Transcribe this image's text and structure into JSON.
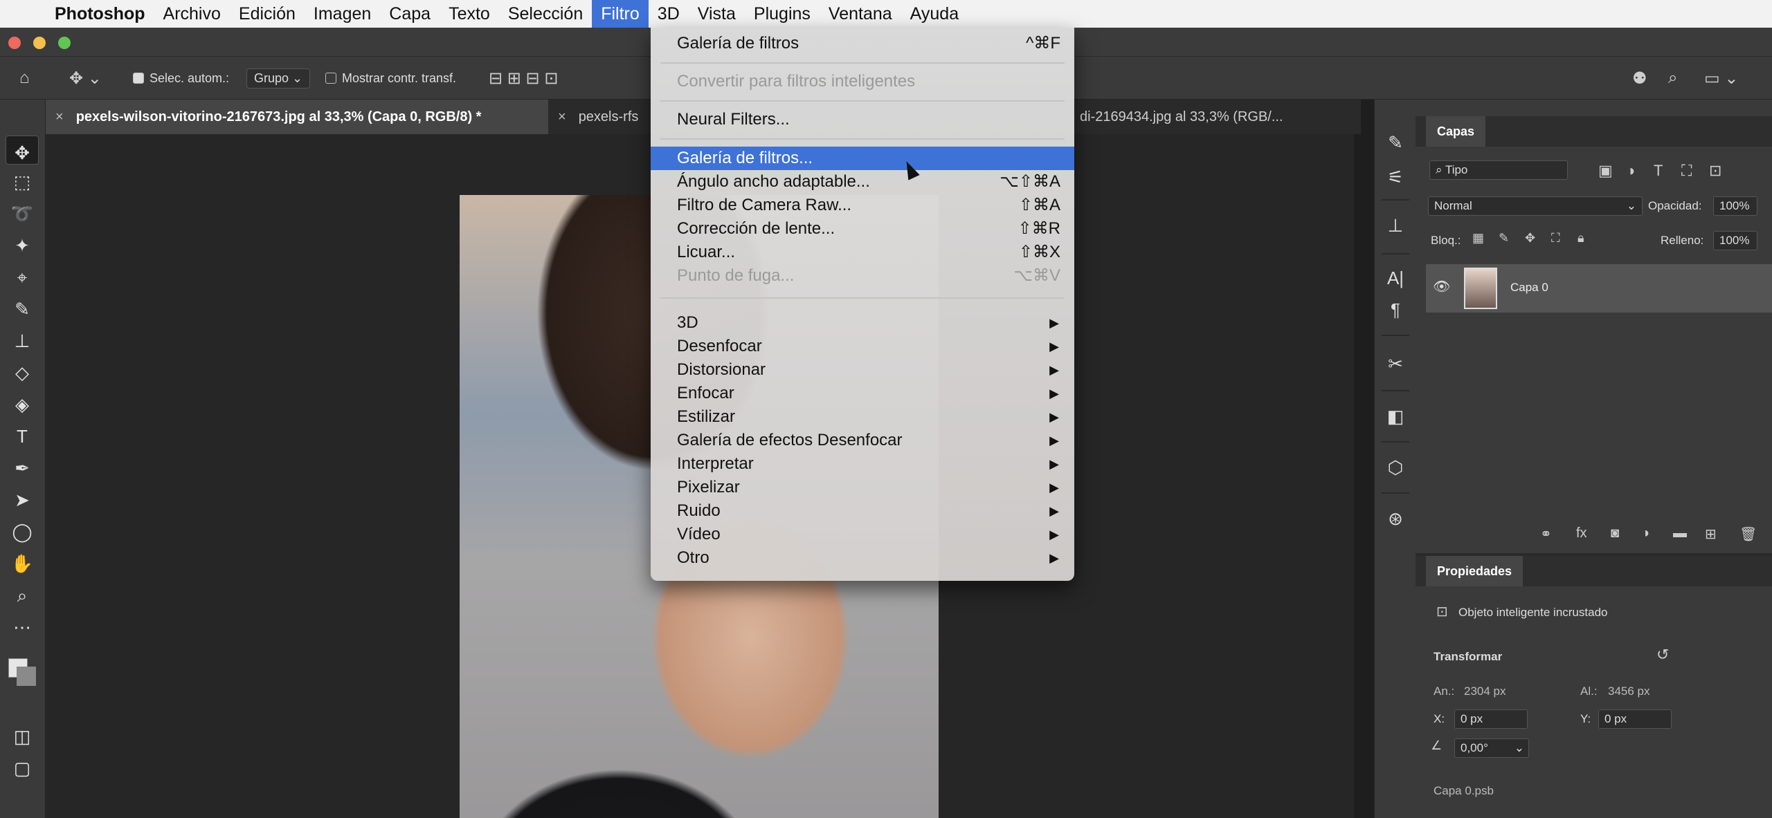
{
  "menubar": {
    "apple": "",
    "items": [
      {
        "label": "Photoshop",
        "bold": true
      },
      {
        "label": "Archivo"
      },
      {
        "label": "Edición"
      },
      {
        "label": "Imagen"
      },
      {
        "label": "Capa"
      },
      {
        "label": "Texto"
      },
      {
        "label": "Selección"
      },
      {
        "label": "Filtro",
        "active": true
      },
      {
        "label": "3D"
      },
      {
        "label": "Vista"
      },
      {
        "label": "Plugins"
      },
      {
        "label": "Ventana"
      },
      {
        "label": "Ayuda"
      }
    ]
  },
  "options_bar": {
    "auto_select_label": "Selec. autom.:",
    "auto_select_value": "Grupo",
    "show_transform_label": "Mostrar contr. transf."
  },
  "tabs": [
    {
      "label": "pexels-wilson-vitorino-2167673.jpg al 33,3% (Capa 0, RGB/8) *",
      "active": true
    },
    {
      "label": "pexels-rfs"
    },
    {
      "label": "di-2169434.jpg al 33,3% (RGB/..."
    }
  ],
  "filter_menu": {
    "items": [
      {
        "label": "Galería de filtros",
        "shortcut": "^⌘F"
      },
      {
        "label": "Convertir para filtros inteligentes",
        "disabled": true
      },
      {
        "label": "Neural Filters..."
      },
      {
        "label": "Galería de filtros...",
        "highlighted": true
      },
      {
        "label": "Ángulo ancho adaptable...",
        "shortcut": "⌥⇧⌘A"
      },
      {
        "label": "Filtro de Camera Raw...",
        "shortcut": "⇧⌘A"
      },
      {
        "label": "Corrección de lente...",
        "shortcut": "⇧⌘R"
      },
      {
        "label": "Licuar...",
        "shortcut": "⇧⌘X"
      },
      {
        "label": "Punto de fuga...",
        "shortcut": "⌥⌘V",
        "disabled": true
      },
      {
        "label": "3D",
        "submenu": true
      },
      {
        "label": "Desenfocar",
        "submenu": true
      },
      {
        "label": "Distorsionar",
        "submenu": true
      },
      {
        "label": "Enfocar",
        "submenu": true
      },
      {
        "label": "Estilizar",
        "submenu": true
      },
      {
        "label": "Galería de efectos Desenfocar",
        "submenu": true
      },
      {
        "label": "Interpretar",
        "submenu": true
      },
      {
        "label": "Pixelizar",
        "submenu": true
      },
      {
        "label": "Ruido",
        "submenu": true
      },
      {
        "label": "Vídeo",
        "submenu": true
      },
      {
        "label": "Otro",
        "submenu": true
      }
    ]
  },
  "layers_panel": {
    "tab": "Capas",
    "filter_kind": "Tipo",
    "blend_mode": "Normal",
    "opacity_label": "Opacidad:",
    "opacity_value": "100%",
    "lock_label": "Bloq.:",
    "fill_label": "Relleno:",
    "fill_value": "100%",
    "layers": [
      {
        "name": "Capa 0",
        "visible": true
      }
    ]
  },
  "properties_panel": {
    "tab": "Propiedades",
    "object_type": "Objeto inteligente incrustado",
    "transform_title": "Transformar",
    "width_label": "An.:",
    "width_value": "2304 px",
    "height_label": "Al.:",
    "height_value": "3456 px",
    "x_label": "X:",
    "x_value": "0 px",
    "y_label": "Y:",
    "y_value": "0 px",
    "angle_value": "0,00°",
    "file_name": "Capa 0.psb"
  },
  "colors": {
    "menu_highlight": "#3f72d6",
    "panel_bg": "#3a3a3a"
  }
}
